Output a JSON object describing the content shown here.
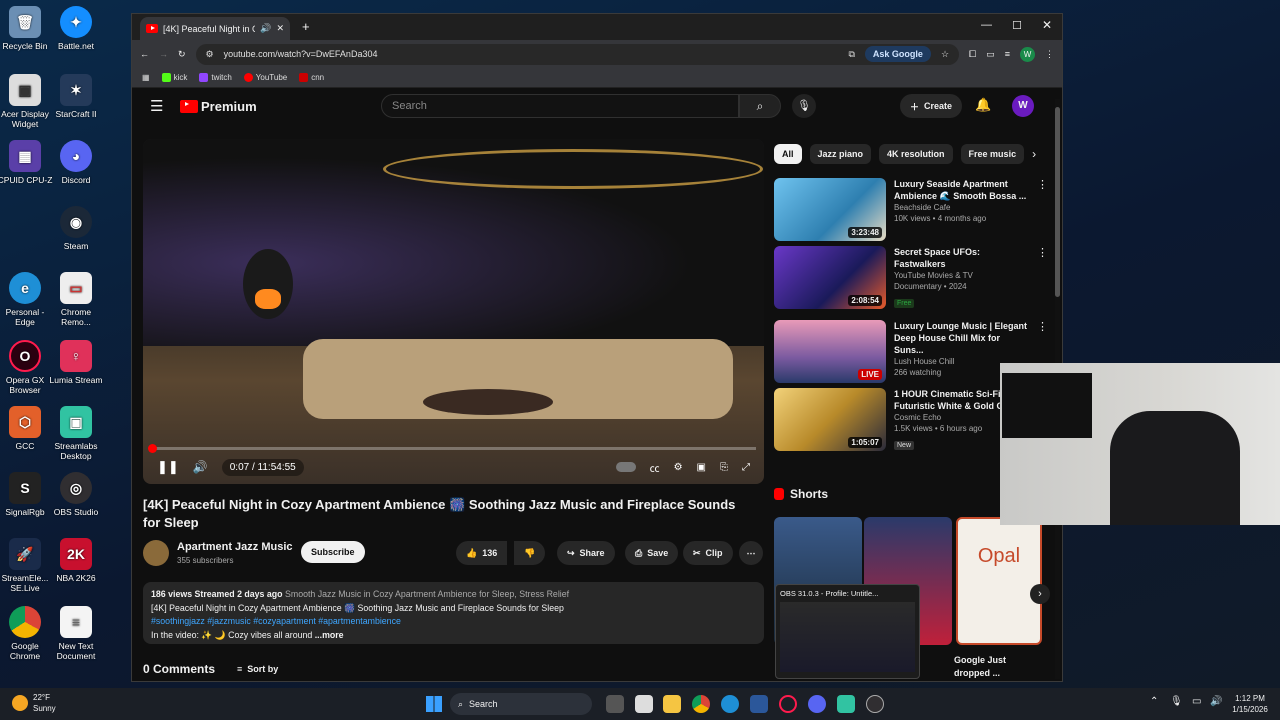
{
  "desktop": {
    "icons_left": [
      "Recycle Bin",
      "Acer Display Widget",
      "CPUID CPU-Z",
      "",
      "Personal - Edge",
      "Opera GX Browser",
      "GCC",
      "SignalRgb",
      "StreamEle... SE.Live",
      "Google Chrome"
    ],
    "icons_right": [
      "Battle.net",
      "StarCraft II",
      "Discord",
      "Steam",
      "Chrome Remo...",
      "Lumia Stream",
      "Streamlabs Desktop",
      "OBS Studio",
      "NBA 2K26",
      "New Text Document"
    ]
  },
  "browser": {
    "tab_title": "[4K] Peaceful Night in Cozy",
    "url": "youtube.com/watch?v=DwEFAnDa304",
    "ask_google": "Ask Google",
    "profile_letter": "W",
    "bookmarks": [
      {
        "label": "kick",
        "color": "#53fc18"
      },
      {
        "label": "twitch",
        "color": "#9146ff"
      },
      {
        "label": "YouTube",
        "color": "#ff0000"
      },
      {
        "label": "cnn",
        "color": "#cc0000"
      }
    ]
  },
  "youtube": {
    "logo_text": "Premium",
    "search_placeholder": "Search",
    "create_label": "Create",
    "avatar_letter": "W",
    "player": {
      "time": "0:07 / 11:54:55",
      "progress": 0.0002
    },
    "video_title": "[4K] Peaceful Night in Cozy Apartment Ambience 🎆 Soothing Jazz Music and Fireplace Sounds for Sleep",
    "channel": {
      "name": "Apartment Jazz Music",
      "subs": "355 subscribers",
      "subscribe": "Subscribe"
    },
    "actions": {
      "likes": "136",
      "share": "Share",
      "save": "Save",
      "clip": "Clip"
    },
    "description": {
      "views": "186 views  Streamed 2 days ago",
      "tags_gray": "Smooth Jazz Music in Cozy Apartment Ambience for Sleep, Stress Relief",
      "line2": "[4K] Peaceful Night in Cozy Apartment Ambience 🎆 Soothing Jazz Music and Fireplace Sounds for Sleep",
      "hashtags": "#soothingjazz #jazzmusic #cozyapartment #apartmentambience",
      "line4": "In the video: ✨ 🌙 Cozy vibes all around",
      "more": "...more"
    },
    "comments": {
      "count": "0 Comments",
      "sort": "Sort by"
    },
    "chips": [
      "All",
      "Jazz piano",
      "4K resolution",
      "Free music"
    ],
    "recommendations": [
      {
        "title": "Luxury Seaside Apartment Ambience 🌊 Smooth Bossa ...",
        "channel": "Beachside Cafe",
        "meta": "10K views • 4 months ago",
        "duration": "3:23:48",
        "badge": "",
        "thumb": "#3a8fc4"
      },
      {
        "title": "Secret Space UFOs: Fastwalkers",
        "channel": "YouTube Movies & TV",
        "meta": "Documentary • 2024",
        "duration": "2:08:54",
        "badge": "Free",
        "thumb": "#2a2a6a"
      },
      {
        "title": "Luxury Lounge Music | Elegant Deep House Chill Mix for Suns...",
        "channel": "Lush House Chill",
        "meta": "266 watching",
        "duration": "LIVE",
        "badge": "",
        "thumb": "#b56a8a"
      },
      {
        "title": "1 HOUR Cinematic Sci-Fi Live | Futuristic White & Gold C...",
        "channel": "Cosmic Echo",
        "meta": "1.5K views • 6 hours ago",
        "duration": "1:05:07",
        "badge": "New",
        "thumb": "#c9a347"
      }
    ],
    "shorts": {
      "heading": "Shorts",
      "short_text": "Opal",
      "short_caption": "Google Just dropped ..."
    }
  },
  "obs_popup": "OBS 31.0.3 - Profile: Untitle...",
  "taskbar": {
    "weather_temp": "22°F",
    "weather_desc": "Sunny",
    "search": "Search",
    "time": "1:12 PM",
    "date": "1/15/2026"
  }
}
